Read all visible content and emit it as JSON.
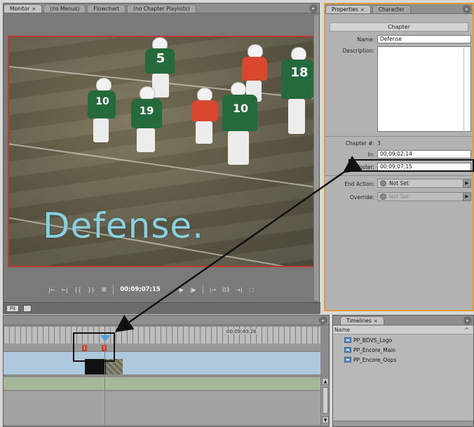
{
  "monitor": {
    "tabs": [
      {
        "label": "Monitor",
        "close": "×"
      },
      {
        "label": "(no Menus)"
      },
      {
        "label": "Flowchart"
      },
      {
        "label": "(no Chapter Playlists)"
      }
    ],
    "overlay_text": "Defense.",
    "jersey_numbers": [
      "5",
      "10",
      "19",
      "18",
      "10"
    ],
    "transport": {
      "controls": [
        "|←",
        "←|",
        "{{",
        "}}",
        "⌘",
        "▶",
        "|▶"
      ],
      "timecode": "00;09;07;15",
      "right_controls": [
        "|→",
        "03",
        "→|",
        "⬚"
      ]
    },
    "status": {
      "zoom": "Fit"
    }
  },
  "properties": {
    "tabs": [
      {
        "label": "Properties",
        "close": "×"
      },
      {
        "label": "Character"
      }
    ],
    "section": "Chapter",
    "name_label": "Name:",
    "name_value": "Defense",
    "description_label": "Description:",
    "chapter_num_label": "Chapter #:",
    "chapter_num_value": "3",
    "in_label": "In:",
    "in_value": "00;09;02;14",
    "poster_label": "Poster:",
    "poster_value": "00;09;07;15",
    "end_action_label": "End Action:",
    "end_action_value": "Not Set",
    "override_label": "Override:",
    "override_value": "Not Set"
  },
  "timeline": {
    "ruler_timecode": "00;09;40;26",
    "marker_labels": [
      "1",
      "3"
    ]
  },
  "timelines_panel": {
    "tabs": [
      {
        "label": "Timelines",
        "close": "×"
      }
    ],
    "column_header": "Name",
    "items": [
      "PP_BDVS_Logo",
      "PP_Encore_Main",
      "PP_Encore_Oops"
    ]
  },
  "colors": {
    "panel_highlight": "#e39a3c",
    "video_border": "#c0392b",
    "playhead": "#e05a2a",
    "overlay_text": "#8ad0df",
    "marker": "#d43a26"
  }
}
